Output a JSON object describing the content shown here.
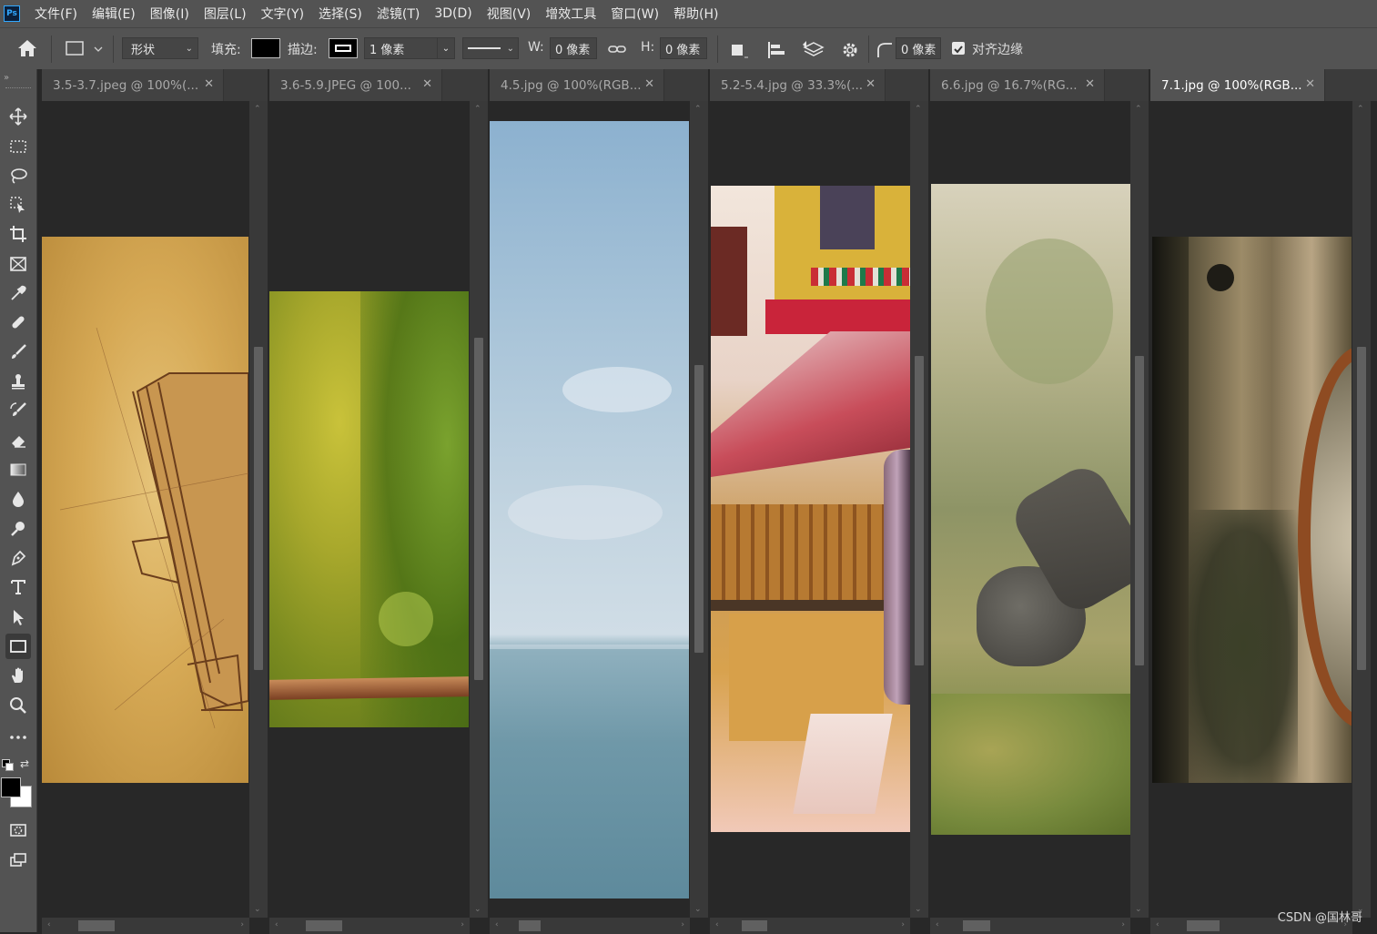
{
  "app": {
    "logo": "Ps"
  },
  "menu": [
    "文件(F)",
    "编辑(E)",
    "图像(I)",
    "图层(L)",
    "文字(Y)",
    "选择(S)",
    "滤镜(T)",
    "3D(D)",
    "视图(V)",
    "增效工具",
    "窗口(W)",
    "帮助(H)"
  ],
  "options": {
    "mode_value": "形状",
    "fill_label": "填充:",
    "fill_color": "#000000",
    "stroke_label": "描边:",
    "stroke_width": "1 像素",
    "w_label": "W:",
    "w_value": "0 像素",
    "h_label": "H:",
    "h_value": "0 像素",
    "radius_value": "0 像素",
    "align_edges_label": "对齐边缘",
    "align_edges_checked": true
  },
  "tools": [
    "move-tool",
    "marquee-tool",
    "lasso-tool",
    "object-select-tool",
    "crop-tool",
    "frame-tool",
    "eyedropper-tool",
    "healing-tool",
    "brush-tool",
    "stamp-tool",
    "history-brush-tool",
    "eraser-tool",
    "gradient-tool",
    "blur-tool",
    "dodge-tool",
    "pen-tool",
    "type-tool",
    "path-select-tool",
    "rectangle-tool",
    "hand-tool",
    "zoom-tool",
    "more-tools",
    "quick-mask",
    "screen-mode"
  ],
  "colors": {
    "foreground": "#000000",
    "background": "#ffffff",
    "accent": "#31a8ff"
  },
  "documents": [
    {
      "tab": "3.5-3.7.jpeg @ 100%(...",
      "active": false
    },
    {
      "tab": "3.6-5.9.JPEG @ 100...",
      "active": false
    },
    {
      "tab": "4.5.jpg @ 100%(RGB...",
      "active": false
    },
    {
      "tab": "5.2-5.4.jpg @ 33.3%(...",
      "active": false
    },
    {
      "tab": "6.6.jpg @ 16.7%(RG...",
      "active": false
    },
    {
      "tab": "7.1.jpg @ 100%(RGB...",
      "active": true
    }
  ],
  "watermark": "CSDN @国林哥"
}
